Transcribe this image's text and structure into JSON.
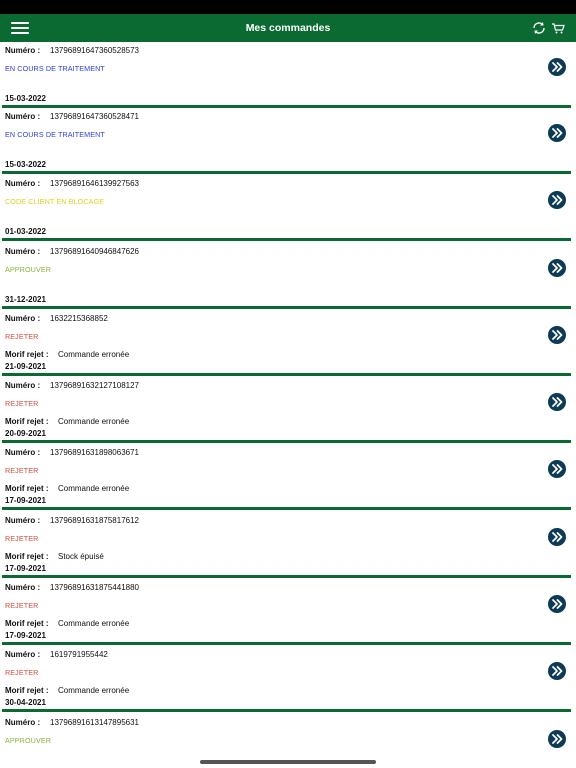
{
  "header": {
    "title": "Mes commandes",
    "background": "#0b6a32",
    "menu_icon": "hamburger-menu-icon",
    "refresh_icon": "refresh-icon",
    "cart_icon": "cart-icon"
  },
  "labels": {
    "numero": "Numéro :",
    "motif_rejet": "Morif rejet :"
  },
  "status_colors": {
    "EN COURS DE TRAITEMENT": "#2d3fd6",
    "CODE CLIENT EN BLOCAGE": "#d8d51c",
    "APPROUVER": "#86b43a",
    "REJETER": "#c8503c"
  },
  "orders": [
    {
      "numero": "13796891647360528573",
      "status": "EN COURS DE TRAITEMENT",
      "motif": "",
      "date": "15-03-2022"
    },
    {
      "numero": "13796891647360528471",
      "status": "EN COURS DE TRAITEMENT",
      "motif": "",
      "date": "15-03-2022"
    },
    {
      "numero": "13796891646139927563",
      "status": "CODE CLIENT EN BLOCAGE",
      "motif": "",
      "date": "01-03-2022"
    },
    {
      "numero": "13796891640946847626",
      "status": "APPROUVER",
      "motif": "",
      "date": "31-12-2021"
    },
    {
      "numero": "1632215368852",
      "status": "REJETER",
      "motif": "Commande erronée",
      "date": "21-09-2021"
    },
    {
      "numero": "13796891632127108127",
      "status": "REJETER",
      "motif": "Commande erronée",
      "date": "20-09-2021"
    },
    {
      "numero": "13796891631898063671",
      "status": "REJETER",
      "motif": "Commande erronée",
      "date": "17-09-2021"
    },
    {
      "numero": "13796891631875817612",
      "status": "REJETER",
      "motif": "Stock épuisé",
      "date": "17-09-2021"
    },
    {
      "numero": "13796891631875441880",
      "status": "REJETER",
      "motif": "Commande erronée",
      "date": "17-09-2021"
    },
    {
      "numero": "1619791955442",
      "status": "REJETER",
      "motif": "Commande erronée",
      "date": "30-04-2021"
    },
    {
      "numero": "13796891613147895631",
      "status": "APPROUVER",
      "motif": "",
      "date": ""
    }
  ]
}
